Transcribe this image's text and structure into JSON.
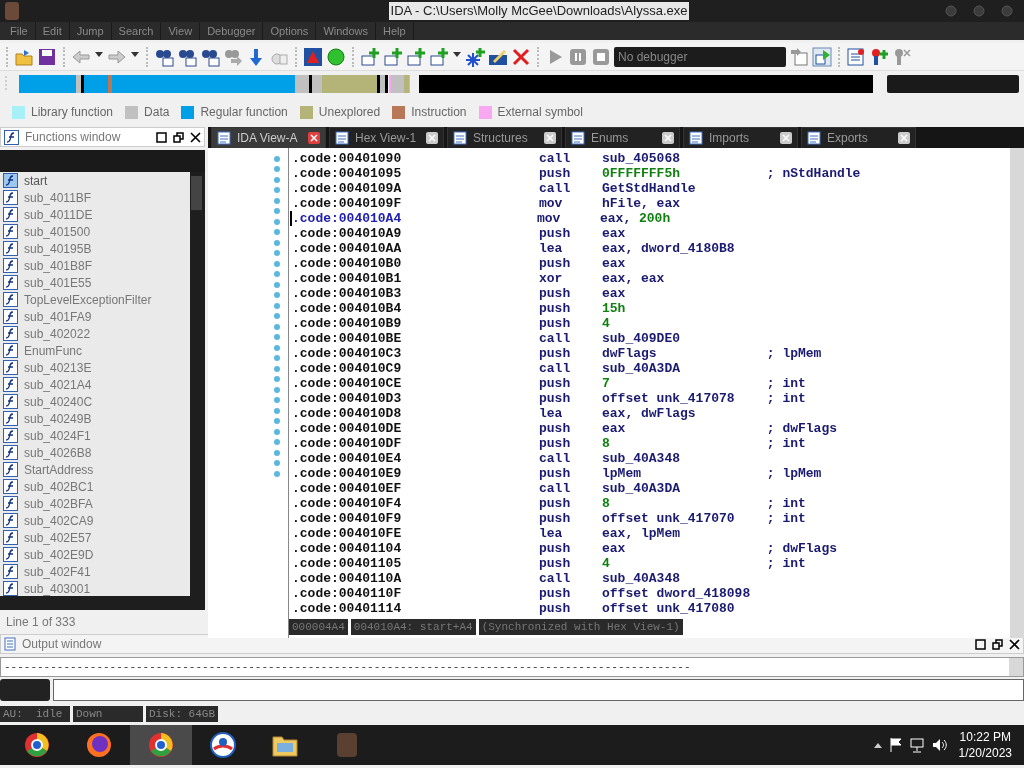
{
  "window": {
    "title": "IDA - C:\\Users\\Molly McGee\\Downloads\\Alyssa.exe"
  },
  "menu": [
    "File",
    "Edit",
    "Jump",
    "Search",
    "View",
    "Debugger",
    "Options",
    "Windows",
    "Help"
  ],
  "toolbar": {
    "debugger": "No debugger"
  },
  "legend": [
    {
      "label": "Library function",
      "color": "#a8f0f8"
    },
    {
      "label": "Data",
      "color": "#c0c0c0"
    },
    {
      "label": "Regular function",
      "color": "#00a0e8"
    },
    {
      "label": "Unexplored",
      "color": "#b4b478"
    },
    {
      "label": "Instruction",
      "color": "#b87858"
    },
    {
      "label": "External symbol",
      "color": "#f8a8f0"
    }
  ],
  "functions_window": {
    "title": "Functions window",
    "status": "Line 1 of 333",
    "items": [
      {
        "name": "start",
        "selected": true
      },
      {
        "name": "sub_4011BF",
        "selected": false
      },
      {
        "name": "sub_4011DE",
        "selected": false
      },
      {
        "name": "sub_401500",
        "selected": false
      },
      {
        "name": "sub_40195B",
        "selected": false
      },
      {
        "name": "sub_401B8F",
        "selected": false
      },
      {
        "name": "sub_401E55",
        "selected": false
      },
      {
        "name": "TopLevelExceptionFilter",
        "selected": false
      },
      {
        "name": "sub_401FA9",
        "selected": false
      },
      {
        "name": "sub_402022",
        "selected": false
      },
      {
        "name": "EnumFunc",
        "selected": false
      },
      {
        "name": "sub_40213E",
        "selected": false
      },
      {
        "name": "sub_4021A4",
        "selected": false
      },
      {
        "name": "sub_40240C",
        "selected": false
      },
      {
        "name": "sub_40249B",
        "selected": false
      },
      {
        "name": "sub_4024F1",
        "selected": false
      },
      {
        "name": "sub_4026B8",
        "selected": false
      },
      {
        "name": "StartAddress",
        "selected": false
      },
      {
        "name": "sub_402BC1",
        "selected": false
      },
      {
        "name": "sub_402BFA",
        "selected": false
      },
      {
        "name": "sub_402CA9",
        "selected": false
      },
      {
        "name": "sub_402E57",
        "selected": false
      },
      {
        "name": "sub_402E9D",
        "selected": false
      },
      {
        "name": "sub_402F41",
        "selected": false
      },
      {
        "name": "sub_403001",
        "selected": false
      }
    ]
  },
  "tabs": [
    {
      "label": "IDA View-A",
      "selected": true
    },
    {
      "label": "Hex View-1",
      "selected": false
    },
    {
      "label": "Structures",
      "selected": false
    },
    {
      "label": "Enums",
      "selected": false
    },
    {
      "label": "Imports",
      "selected": false
    },
    {
      "label": "Exports",
      "selected": false
    }
  ],
  "code_lines": [
    {
      "address": ".code:00401090",
      "mnemonic": "call",
      "operand": [
        {
          "text": "sub_405068",
          "kind": "name"
        }
      ],
      "current": false
    },
    {
      "address": ".code:00401095",
      "mnemonic": "push",
      "operand": [
        {
          "text": "0FFFFFFF5h",
          "kind": "number"
        }
      ],
      "comment": "; nStdHandle",
      "current": false
    },
    {
      "address": ".code:0040109A",
      "mnemonic": "call",
      "operand": [
        {
          "text": "GetStdHandle",
          "kind": "name"
        }
      ],
      "current": false
    },
    {
      "address": ".code:0040109F",
      "mnemonic": "mov",
      "operand": [
        {
          "text": "hFile, eax",
          "kind": "name"
        }
      ],
      "current": false
    },
    {
      "address": ".code:004010A4",
      "mnemonic": "mov",
      "operand": [
        {
          "text": "eax, ",
          "kind": "name"
        },
        {
          "text": "200h",
          "kind": "number"
        }
      ],
      "current": true
    },
    {
      "address": ".code:004010A9",
      "mnemonic": "push",
      "operand": [
        {
          "text": "eax",
          "kind": "name"
        }
      ],
      "current": false
    },
    {
      "address": ".code:004010AA",
      "mnemonic": "lea",
      "operand": [
        {
          "text": "eax, dword_4180B8",
          "kind": "name"
        }
      ],
      "current": false
    },
    {
      "address": ".code:004010B0",
      "mnemonic": "push",
      "operand": [
        {
          "text": "eax",
          "kind": "name"
        }
      ],
      "current": false
    },
    {
      "address": ".code:004010B1",
      "mnemonic": "xor",
      "operand": [
        {
          "text": "eax, eax",
          "kind": "name"
        }
      ],
      "current": false
    },
    {
      "address": ".code:004010B3",
      "mnemonic": "push",
      "operand": [
        {
          "text": "eax",
          "kind": "name"
        }
      ],
      "current": false
    },
    {
      "address": ".code:004010B4",
      "mnemonic": "push",
      "operand": [
        {
          "text": "15h",
          "kind": "number"
        }
      ],
      "current": false
    },
    {
      "address": ".code:004010B9",
      "mnemonic": "push",
      "operand": [
        {
          "text": "4",
          "kind": "number"
        }
      ],
      "current": false
    },
    {
      "address": ".code:004010BE",
      "mnemonic": "call",
      "operand": [
        {
          "text": "sub_409DE0",
          "kind": "name"
        }
      ],
      "current": false
    },
    {
      "address": ".code:004010C3",
      "mnemonic": "push",
      "operand": [
        {
          "text": "dwFlags",
          "kind": "name"
        }
      ],
      "comment": "; lpMem",
      "current": false
    },
    {
      "address": ".code:004010C9",
      "mnemonic": "call",
      "operand": [
        {
          "text": "sub_40A3DA",
          "kind": "name"
        }
      ],
      "current": false
    },
    {
      "address": ".code:004010CE",
      "mnemonic": "push",
      "operand": [
        {
          "text": "7",
          "kind": "number"
        }
      ],
      "comment": "; int",
      "current": false
    },
    {
      "address": ".code:004010D3",
      "mnemonic": "push",
      "operand": [
        {
          "text": "offset unk_417078",
          "kind": "name"
        }
      ],
      "comment": "; int",
      "current": false
    },
    {
      "address": ".code:004010D8",
      "mnemonic": "lea",
      "operand": [
        {
          "text": "eax, dwFlags",
          "kind": "name"
        }
      ],
      "current": false
    },
    {
      "address": ".code:004010DE",
      "mnemonic": "push",
      "operand": [
        {
          "text": "eax",
          "kind": "name"
        }
      ],
      "comment": "; dwFlags",
      "current": false
    },
    {
      "address": ".code:004010DF",
      "mnemonic": "push",
      "operand": [
        {
          "text": "8",
          "kind": "number"
        }
      ],
      "comment": "; int",
      "current": false
    },
    {
      "address": ".code:004010E4",
      "mnemonic": "call",
      "operand": [
        {
          "text": "sub_40A348",
          "kind": "name"
        }
      ],
      "current": false
    },
    {
      "address": ".code:004010E9",
      "mnemonic": "push",
      "operand": [
        {
          "text": "lpMem",
          "kind": "name"
        }
      ],
      "comment": "; lpMem",
      "current": false
    },
    {
      "address": ".code:004010EF",
      "mnemonic": "call",
      "operand": [
        {
          "text": "sub_40A3DA",
          "kind": "name"
        }
      ],
      "current": false
    },
    {
      "address": ".code:004010F4",
      "mnemonic": "push",
      "operand": [
        {
          "text": "8",
          "kind": "number"
        }
      ],
      "comment": "; int",
      "current": false
    },
    {
      "address": ".code:004010F9",
      "mnemonic": "push",
      "operand": [
        {
          "text": "offset unk_417070",
          "kind": "name"
        }
      ],
      "comment": "; int",
      "current": false
    },
    {
      "address": ".code:004010FE",
      "mnemonic": "lea",
      "operand": [
        {
          "text": "eax, lpMem",
          "kind": "name"
        }
      ],
      "current": false
    },
    {
      "address": ".code:00401104",
      "mnemonic": "push",
      "operand": [
        {
          "text": "eax",
          "kind": "name"
        }
      ],
      "comment": "; dwFlags",
      "current": false
    },
    {
      "address": ".code:00401105",
      "mnemonic": "push",
      "operand": [
        {
          "text": "4",
          "kind": "number"
        }
      ],
      "comment": "; int",
      "current": false
    },
    {
      "address": ".code:0040110A",
      "mnemonic": "call",
      "operand": [
        {
          "text": "sub_40A348",
          "kind": "name"
        }
      ],
      "current": false
    },
    {
      "address": ".code:0040110F",
      "mnemonic": "push",
      "operand": [
        {
          "text": "offset dword_418098",
          "kind": "name"
        }
      ],
      "current": false
    },
    {
      "address": ".code:00401114",
      "mnemonic": "push",
      "operand": [
        {
          "text": "offset unk_417080",
          "kind": "name"
        }
      ],
      "current": false
    }
  ],
  "view_status": [
    "000004A4",
    "004010A4: start+A4",
    "(Synchronized with Hex View-1)"
  ],
  "output_window": {
    "title": "Output window",
    "lines": [
      "--------------------------------------------------------------------------------------------------------"
    ]
  },
  "status_bar": [
    "AU:  idle",
    "Down",
    "Disk: 64GB"
  ],
  "taskbar": {
    "apps": [
      {
        "selected": false
      },
      {
        "selected": false
      },
      {
        "selected": true
      },
      {
        "selected": false
      },
      {
        "selected": false
      },
      {
        "selected": false
      }
    ],
    "time": "10:22 PM",
    "date": "1/20/2023"
  }
}
